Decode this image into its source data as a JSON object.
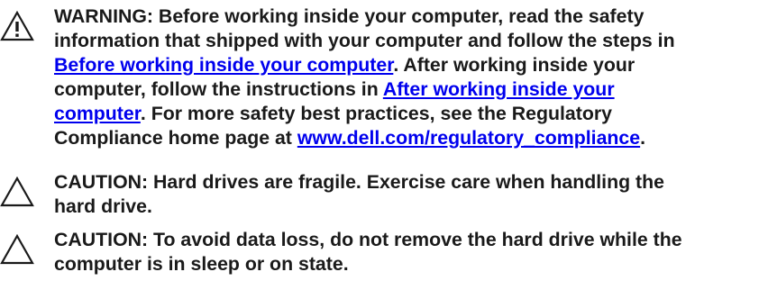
{
  "warning": {
    "icon": "warning-icon",
    "line1": "WARNING: Before working inside your computer, read the safety",
    "line2": "information that shipped with your computer and follow the steps in",
    "link_before": "Before working inside your computer",
    "line3_after": ". After working inside your",
    "line4_before": "computer, follow the instructions in ",
    "link_after_part1": "After working inside your",
    "link_after_part2": "computer",
    "line5_after": ". For more safety best practices, see the Regulatory",
    "line6_before": "Compliance home page at ",
    "link_regulatory": "www.dell.com/regulatory_compliance",
    "line6_after": "."
  },
  "caution1": {
    "icon": "caution-icon",
    "line1": "CAUTION: Hard drives are fragile. Exercise care when handling the",
    "line2": "hard drive."
  },
  "caution2": {
    "icon": "caution-icon",
    "line1": "CAUTION: To avoid data loss, do not remove the hard drive while the",
    "line2": "computer is in sleep or on state."
  },
  "colors": {
    "text": "#1a1a1a",
    "link": "#0000ee"
  }
}
